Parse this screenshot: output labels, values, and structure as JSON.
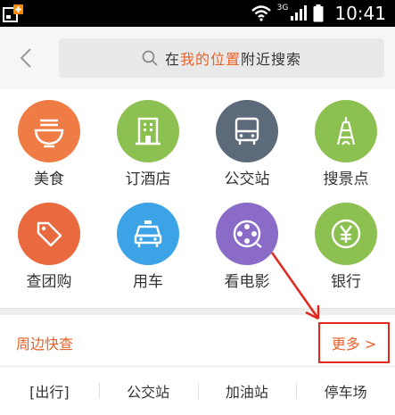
{
  "status_bar": {
    "network": "3G",
    "time": "10:41"
  },
  "header": {
    "search": {
      "prefix": "在",
      "highlight": "我的位置",
      "suffix": "附近搜索"
    }
  },
  "categories": [
    {
      "label": "美食",
      "icon": "noodle-bowl-icon",
      "color": "#ef7c45"
    },
    {
      "label": "订酒店",
      "icon": "hotel-building-icon",
      "color": "#8cc152"
    },
    {
      "label": "公交站",
      "icon": "bus-icon",
      "color": "#5d6a7a"
    },
    {
      "label": "搜景点",
      "icon": "tower-icon",
      "color": "#8cc152"
    },
    {
      "label": "查团购",
      "icon": "tag-icon",
      "color": "#e96a3e"
    },
    {
      "label": "用车",
      "icon": "taxi-icon",
      "color": "#3ba3e6"
    },
    {
      "label": "看电影",
      "icon": "film-reel-icon",
      "color": "#8a6bc7"
    },
    {
      "label": "银行",
      "icon": "yuan-icon",
      "color": "#8cc152"
    }
  ],
  "nearby": {
    "title": "周边快查",
    "more": "更多 >"
  },
  "quick_tabs": [
    "[出行]",
    "公交站",
    "加油站",
    "停车场"
  ],
  "colors": {
    "accent": "#e8622a",
    "annotation": "#e0281f"
  }
}
